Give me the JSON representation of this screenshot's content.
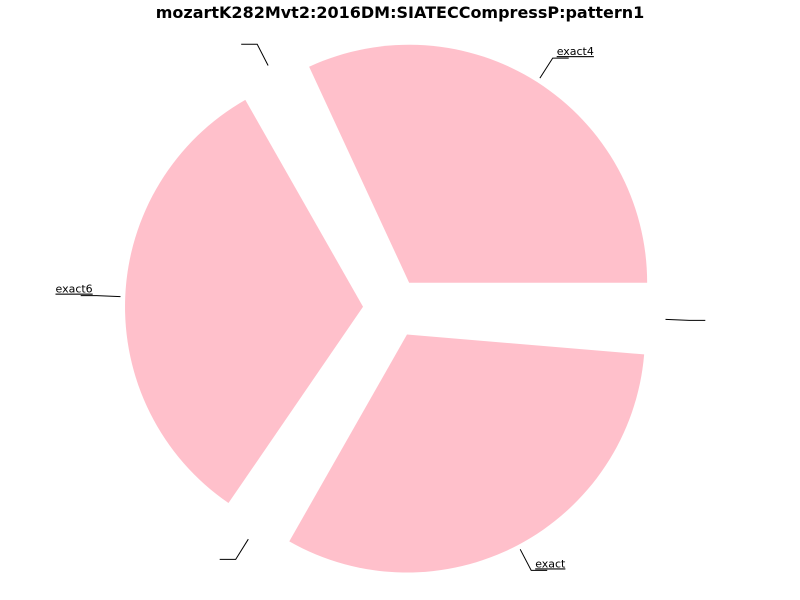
{
  "chart_data": {
    "type": "pie",
    "title": "mozartK282Mvt2:2016DM:SIATECCompressP:pattern1",
    "slices": [
      {
        "label": "exact4",
        "value": 0.319
      },
      {
        "label": "",
        "value": 0.0133
      },
      {
        "label": "exact6",
        "value": 0.322
      },
      {
        "label": "",
        "value": 0.0133
      },
      {
        "label": "exact",
        "value": 0.319
      },
      {
        "label": "",
        "value": 0.0133
      }
    ],
    "slice_color": "#ffc0cb",
    "leader_color": "#000000",
    "start_angle_deg": 0,
    "direction": "counterclockwise",
    "exploded": true,
    "legend": "none"
  }
}
